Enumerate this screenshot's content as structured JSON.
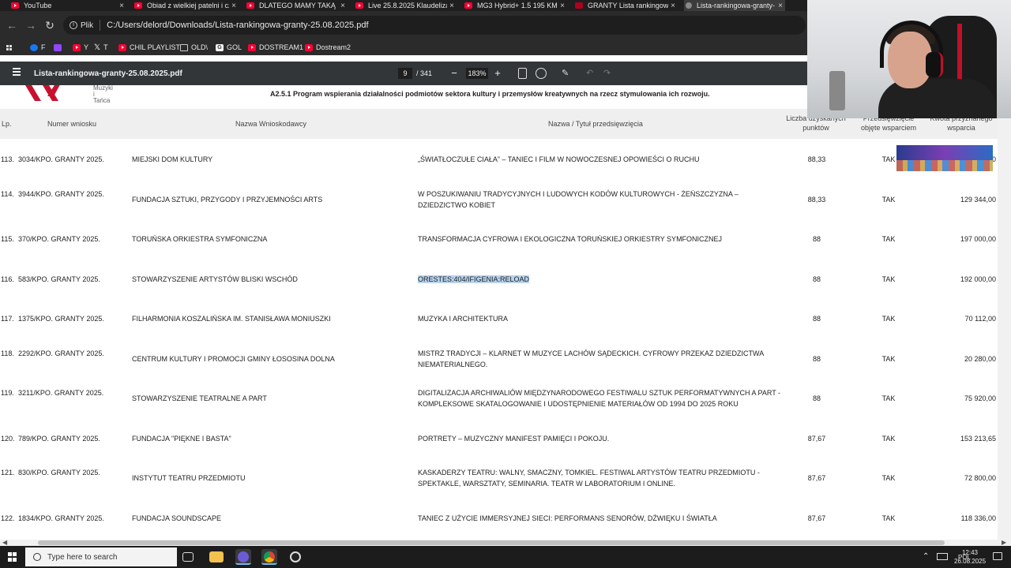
{
  "tabs": [
    {
      "label": "YouTube",
      "kind": "yt"
    },
    {
      "label": "Obiad z wielkiej patelni i cz",
      "kind": "yt"
    },
    {
      "label": "DLATEGO MAMY TAKĄ D",
      "kind": "yt"
    },
    {
      "label": "Live 25.8.2025 Klaudeliza",
      "kind": "yt"
    },
    {
      "label": "MG3 Hybrid+ 1.5 195 KM",
      "kind": "yt"
    },
    {
      "label": "GRANTY Lista rankingow",
      "kind": "gr"
    },
    {
      "label": "Lista-rankingowa-granty-",
      "kind": "pdf"
    }
  ],
  "address": {
    "scheme_label": "Plik",
    "url": "C:/Users/delord/Downloads/Lista-rankingowa-granty-25.08.2025.pdf"
  },
  "bookmarks": [
    {
      "label": "F",
      "icon": "facebook-icon"
    },
    {
      "label": "",
      "icon": "twitch-icon"
    },
    {
      "label": "Y",
      "icon": "youtube-icon"
    },
    {
      "label": "T",
      "icon": "x-icon"
    },
    {
      "label": "CHIL PLAYLIST",
      "icon": "youtube-icon"
    },
    {
      "label": "OLD\\",
      "icon": "folder-icon"
    },
    {
      "label": "GOL",
      "icon": "g-icon"
    },
    {
      "label": "DOSTREAM1",
      "icon": "youtube-icon"
    },
    {
      "label": "Dostream2",
      "icon": "youtube-icon"
    }
  ],
  "pdf": {
    "filename": "Lista-rankingowa-granty-25.08.2025.pdf",
    "page": "9",
    "page_total": "/ 341",
    "zoom": "183%"
  },
  "doc": {
    "logo_text_1": "Muzyki",
    "logo_text_2": "i Tańca",
    "programme": "A2.5.1 Program wspierania działalności podmiotów sektora kultury i przemysłów kreatywnych na rzecz stymulowania ich rozwoju.",
    "headers": {
      "lp": "Lp.",
      "nr": "Numer wniosku",
      "nw": "Nazwa Wnioskodawcy",
      "ti": "Nazwa / Tytuł przedsięwzięcia",
      "pk1": "Liczba uzyskanych",
      "pk2": "punktów",
      "ob1": "Przedsięwzięcie",
      "ob2": "objęte wsparciem",
      "kw1": "Kwota przyznanego",
      "kw2": "wsparcia"
    },
    "rows": [
      {
        "lp": "113.",
        "nr": "3034/KPO. GRANTY 2025.",
        "nw": "MIEJSKI DOM KULTURY",
        "t1": "„ŚWIATŁOCZUŁE CIAŁA” – TANIEC I FILM W NOWOCZESNEJ OPOWIEŚCI O RUCHU",
        "t2": "",
        "pk": "88,33",
        "ob": "TAK",
        "kw": "0"
      },
      {
        "lp": "114.",
        "nr": "3944/KPO. GRANTY 2025.",
        "nw": "FUNDACJA SZTUKI, PRZYGODY I PRZYJEMNOŚCI ARTS",
        "t1": "W POSZUKIWANIU TRADYCYJNYCH I LUDOWYCH KODÓW KULTUROWYCH - ŻEŃSZCZYZNA –",
        "t2": "DZIEDZICTWO KOBIET",
        "pk": "88,33",
        "ob": "TAK",
        "kw": "129 344,00"
      },
      {
        "lp": "115.",
        "nr": "370/KPO. GRANTY 2025.",
        "nw": "TORUŃSKA ORKIESTRA SYMFONICZNA",
        "t1": "TRANSFORMACJA CYFROWA I EKOLOGICZNA TORUŃSKIEJ ORKIESTRY SYMFONICZNEJ",
        "t2": "",
        "pk": "88",
        "ob": "TAK",
        "kw": "197 000,00"
      },
      {
        "lp": "116.",
        "nr": "583/KPO. GRANTY 2025.",
        "nw": "STOWARZYSZENIE ARTYSTÓW BLISKI WSCHÓD",
        "t1": "ORESTES:404/IFIGENIA:RELOAD",
        "t2": "",
        "pk": "88",
        "ob": "TAK",
        "kw": "192 000,00"
      },
      {
        "lp": "117.",
        "nr": "1375/KPO. GRANTY 2025.",
        "nw": "FILHARMONIA KOSZALIŃSKA IM. STANISŁAWA MONIUSZKI",
        "t1": "MUZYKA I ARCHITEKTURA",
        "t2": "",
        "pk": "88",
        "ob": "TAK",
        "kw": "70 112,00"
      },
      {
        "lp": "118.",
        "nr": "2292/KPO. GRANTY 2025.",
        "nw": "CENTRUM KULTURY I PROMOCJI GMINY ŁOSOSINA DOLNA",
        "t1": "MISTRZ TRADYCJI – KLARNET W MUZYCE LACHÓW SĄDECKICH. CYFROWY PRZEKAZ DZIEDZICTWA",
        "t2": "NIEMATERIALNEGO.",
        "pk": "88",
        "ob": "TAK",
        "kw": "20 280,00"
      },
      {
        "lp": "119.",
        "nr": "3211/KPO. GRANTY 2025.",
        "nw": "STOWARZYSZENIE TEATRALNE A PART",
        "t1": "DIGITALIZACJA ARCHIWALIÓW MIĘDZYNARODOWEGO FESTIWALU SZTUK PERFORMATYWNYCH A PART -",
        "t2": "KOMPLEKSOWE SKATALOGOWANIE I UDOSTĘPNIENIE MATERIAŁÓW OD 1994 DO 2025 ROKU",
        "pk": "88",
        "ob": "TAK",
        "kw": "75 920,00"
      },
      {
        "lp": "120.",
        "nr": "789/KPO. GRANTY 2025.",
        "nw": "FUNDACJA \"PIĘKNE I BASTA\"",
        "t1": "PORTRETY – MUZYCZNY MANIFEST PAMIĘCI I POKOJU.",
        "t2": "",
        "pk": "87,67",
        "ob": "TAK",
        "kw": "153 213,65"
      },
      {
        "lp": "121.",
        "nr": "830/KPO. GRANTY 2025.",
        "nw": "INSTYTUT TEATRU PRZEDMIOTU",
        "t1": "KASKADERZY TEATRU: WALNY, SMACZNY, TOMKIEL. FESTIWAL ARTYSTÓW TEATRU PRZEDMIOTU -",
        "t2": "SPEKTAKLE, WARSZTATY, SEMINARIA. TEATR W LABORATORIUM I ONLINE.",
        "pk": "87,67",
        "ob": "TAK",
        "kw": "72 800,00"
      },
      {
        "lp": "122.",
        "nr": "1834/KPO. GRANTY 2025.",
        "nw": "FUNDACJA SOUNDSCAPE",
        "t1": "TANIEC Z UŻYCIE IMMERSYJNEJ SIECI: PERFORMANS SENORÓW, DŹWIĘKU I ŚWIATŁA",
        "t2": "",
        "pk": "87,67",
        "ob": "TAK",
        "kw": "118 336,00"
      }
    ]
  },
  "taskbar": {
    "search_placeholder": "Type here to search",
    "lang": "POL",
    "time": "12:43",
    "date": "26.08.2025"
  },
  "colors": {
    "highlight": "#b9d3ee",
    "youtube_red": "#ff0033",
    "pdf_toolbar": "#323639"
  }
}
